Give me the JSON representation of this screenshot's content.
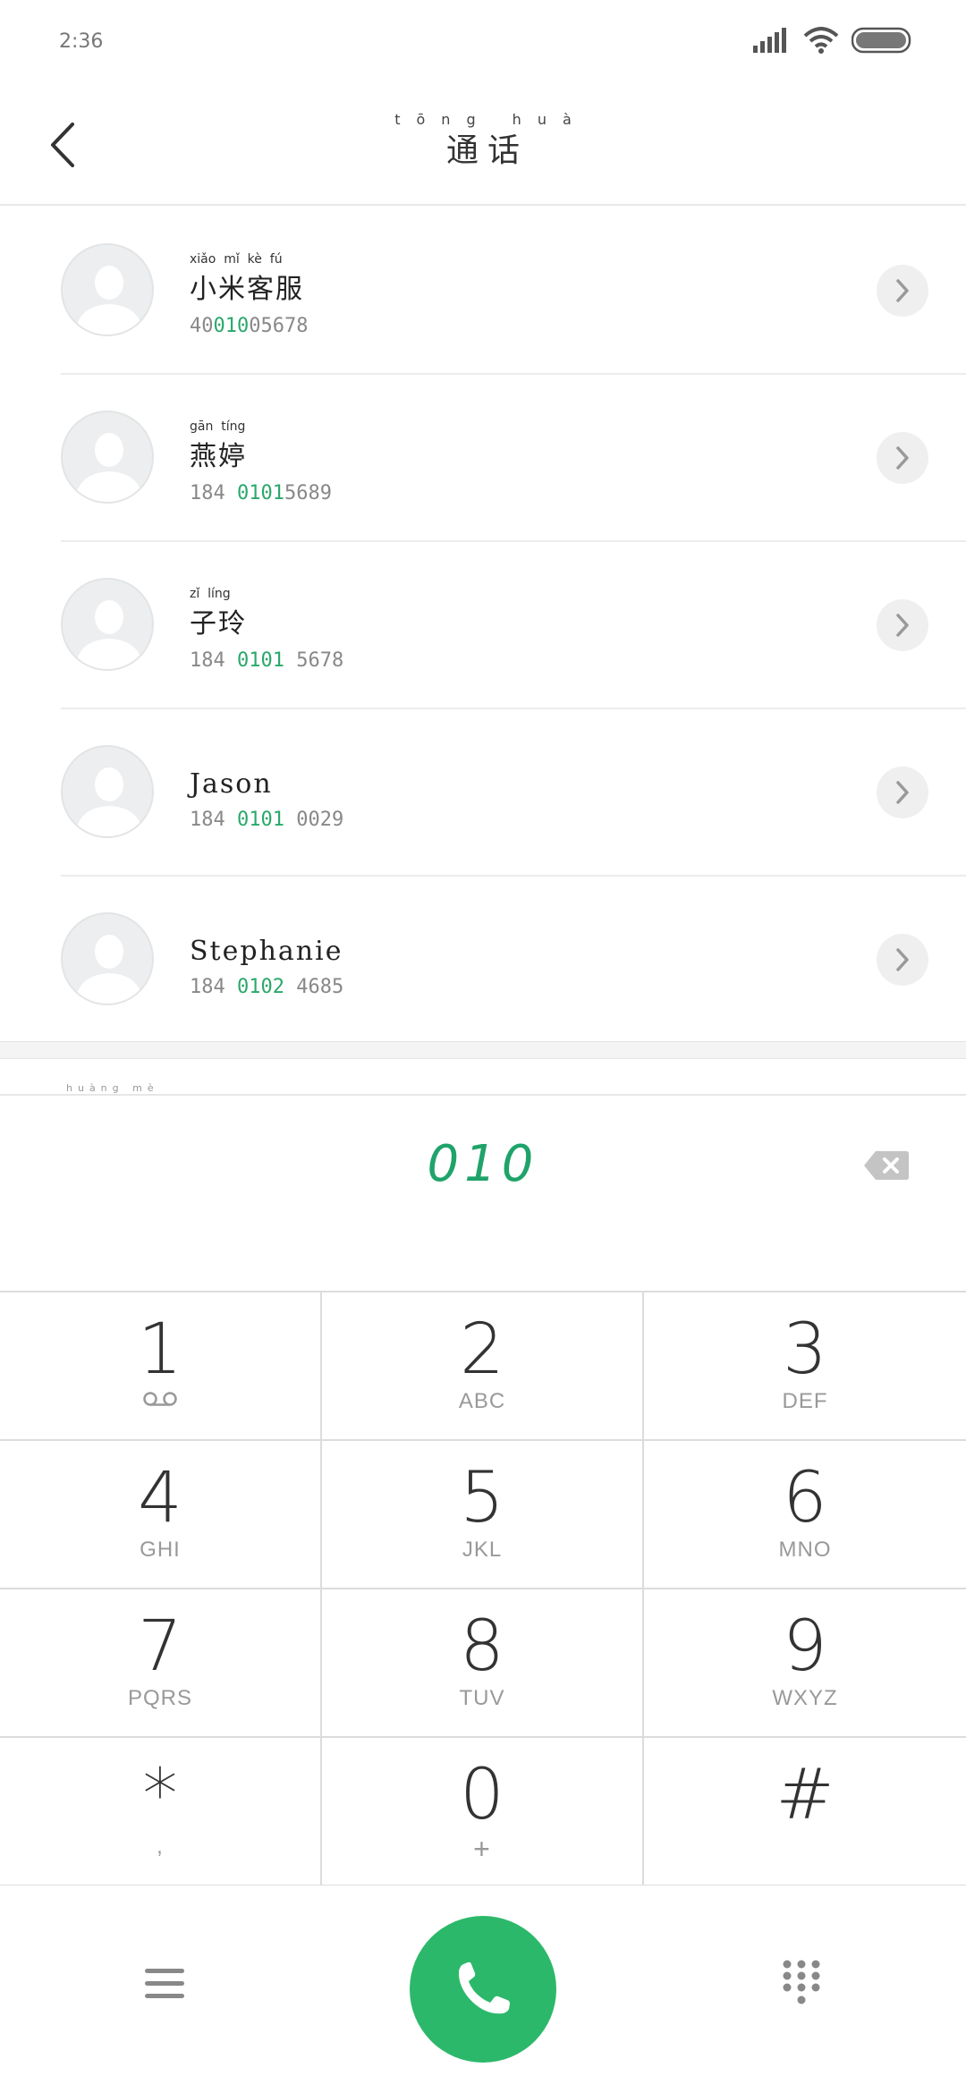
{
  "status_bar": {
    "time": "2:36",
    "icons": [
      "signal-icon",
      "wifi-icon",
      "battery-icon"
    ]
  },
  "header": {
    "title_pinyin": "tōng huà",
    "title": "通话",
    "back_icon": "back-arrow-icon"
  },
  "contacts": [
    {
      "name_pinyin": "xiǎo  mǐ  kè  fú",
      "name": "小米客服",
      "number_pre": "40",
      "number_hl": "010",
      "number_post": "05678"
    },
    {
      "name_pinyin": "gān  tíng",
      "name": "燕婷",
      "number_pre": "184 ",
      "number_hl": "0101",
      "number_post": "5689"
    },
    {
      "name_pinyin": "zǐ  líng",
      "name": "子玲",
      "number_pre": "184 ",
      "number_hl": "0101",
      "number_post": " 5678"
    },
    {
      "name_pinyin": "",
      "name": "Jason",
      "number_pre": "184 ",
      "number_hl": "0101",
      "number_post": " 0029"
    },
    {
      "name_pinyin": "",
      "name": "Stephanie",
      "number_pre": "184 ",
      "number_hl": "0102",
      "number_post": " 4685"
    }
  ],
  "keypad_hint": "huàng  mè",
  "input": {
    "digits": "010",
    "backspace_icon": "backspace-icon"
  },
  "keypad": [
    {
      "digit": "1",
      "letters": "",
      "sub_icon": "voicemail-icon"
    },
    {
      "digit": "2",
      "letters": "ABC"
    },
    {
      "digit": "3",
      "letters": "DEF"
    },
    {
      "digit": "4",
      "letters": "GHI"
    },
    {
      "digit": "5",
      "letters": "JKL"
    },
    {
      "digit": "6",
      "letters": "MNO"
    },
    {
      "digit": "7",
      "letters": "PQRS"
    },
    {
      "digit": "8",
      "letters": "TUV"
    },
    {
      "digit": "9",
      "letters": "WXYZ"
    },
    {
      "digit": "*",
      "letters": ","
    },
    {
      "digit": "0",
      "letters": "+"
    },
    {
      "digit": "#",
      "letters": ""
    }
  ],
  "bottom_bar": {
    "menu_icon": "menu-icon",
    "call_icon": "phone-icon",
    "dialpad_icon": "dialpad-icon"
  },
  "colors": {
    "accent_green": "#2cb86a",
    "highlight_green": "#2aa86a"
  }
}
